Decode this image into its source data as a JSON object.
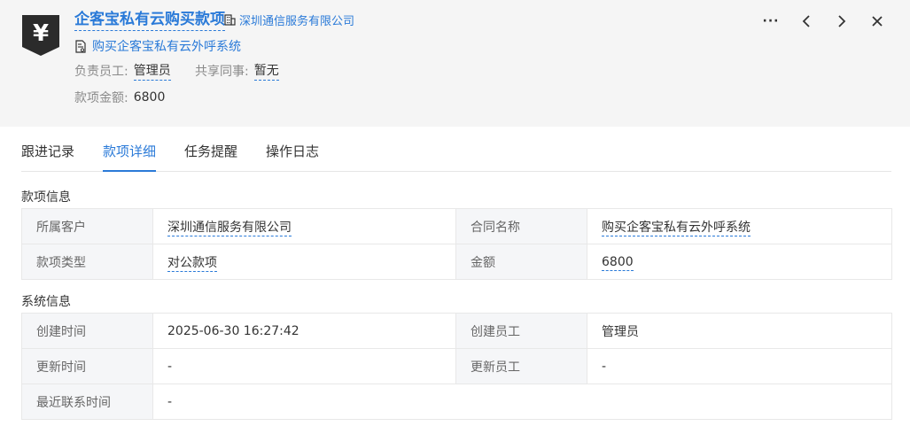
{
  "header": {
    "title": "企客宝私有云购买款项",
    "company": "深圳通信服务有限公司",
    "contract": "购买企客宝私有云外呼系统",
    "owner_label": "负责员工:",
    "owner_value": "管理员",
    "shared_label": "共享同事:",
    "shared_value": "暂无",
    "amount_label": "款项金额:",
    "amount_value": "6800",
    "logo_symbol": "¥",
    "more_label": "···"
  },
  "tabs": [
    {
      "label": "跟进记录"
    },
    {
      "label": "款项详细",
      "active": true
    },
    {
      "label": "任务提醒"
    },
    {
      "label": "操作日志"
    }
  ],
  "payment_info": {
    "title": "款项信息",
    "rows": [
      {
        "l1": "所属客户",
        "v1": "深圳通信服务有限公司",
        "l2": "合同名称",
        "v2": "购买企客宝私有云外呼系统"
      },
      {
        "l1": "款项类型",
        "v1": "对公款项",
        "l2": "金额",
        "v2": "6800"
      }
    ]
  },
  "system_info": {
    "title": "系统信息",
    "rows": [
      {
        "l1": "创建时间",
        "v1": "2025-06-30 16:27:42",
        "l2": "创建员工",
        "v2": "管理员"
      },
      {
        "l1": "更新时间",
        "v1": "-",
        "l2": "更新员工",
        "v2": "-"
      },
      {
        "l1": "最近联系时间",
        "v1": "-"
      }
    ]
  },
  "colors": {
    "accent": "#2a7ad8",
    "header_bg": "#f5f5f5",
    "label_bg": "#f5f6f8"
  }
}
